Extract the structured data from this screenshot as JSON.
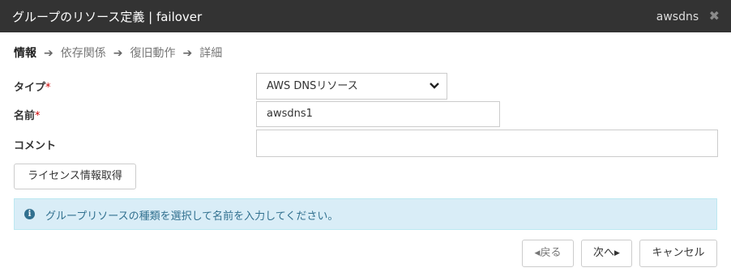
{
  "window": {
    "title": "グループのリソース定義 | failover",
    "resource_name": "awsdns",
    "close_symbol": "✖"
  },
  "steps": [
    {
      "label": "情報",
      "active": true
    },
    {
      "label": "依存関係",
      "active": false
    },
    {
      "label": "復旧動作",
      "active": false
    },
    {
      "label": "詳細",
      "active": false
    }
  ],
  "step_arrow": "➔",
  "form": {
    "type_label": "タイプ",
    "type_value": "AWS DNSリソース",
    "name_label": "名前",
    "name_value": "awsdns1",
    "comment_label": "コメント",
    "comment_value": "",
    "required_mark": "*"
  },
  "license_button": "ライセンス情報取得",
  "info": {
    "icon": "info-circle",
    "message": "グループリソースの種類を選択して名前を入力してください。"
  },
  "buttons": {
    "back": "戻る",
    "next": "次へ",
    "cancel": "キャンセル"
  },
  "colors": {
    "titlebar": "#333333",
    "info_bg": "#d9edf7",
    "info_text": "#31708f",
    "required": "#cc0000"
  }
}
